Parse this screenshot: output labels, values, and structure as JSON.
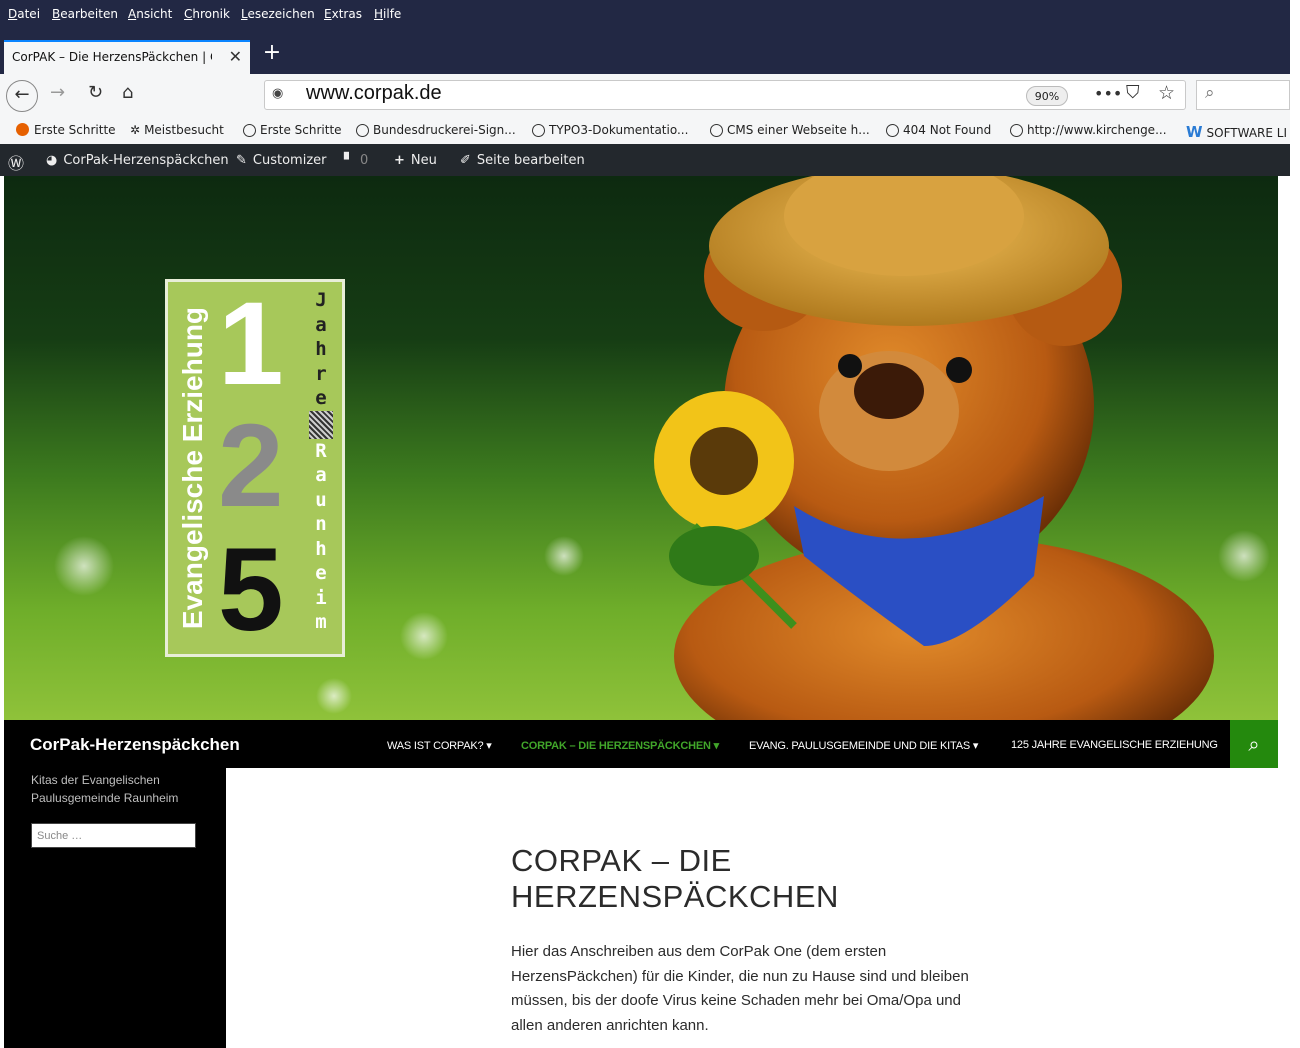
{
  "browser": {
    "menu": [
      "Datei",
      "Bearbeiten",
      "Ansicht",
      "Chronik",
      "Lesezeichen",
      "Extras",
      "Hilfe"
    ],
    "tab_title": "CorPAK – Die HerzensPäckchen | Co",
    "url": "www.corpak.de",
    "zoom": "90%",
    "bookmarks": [
      "Erste Schritte",
      "Meistbesucht",
      "Erste Schritte",
      "Bundesdruckerei-Sign...",
      "TYPO3-Dokumentatio...",
      "CMS einer Webseite h...",
      "404 Not Found",
      "http://www.kirchenge...",
      "SOFTWARE LI"
    ]
  },
  "wpbar": {
    "site": "CorPak-Herzenspäckchen",
    "customizer": "Customizer",
    "comments": "0",
    "new": "Neu",
    "edit": "Seite bearbeiten"
  },
  "hero": {
    "badge_vertical": "Evangelische Erziehung",
    "digits": [
      "1",
      "2",
      "5"
    ],
    "side_letters": [
      "J",
      "a",
      "h",
      "r",
      "e",
      "R",
      "a",
      "u",
      "n",
      "h",
      "e",
      "i",
      "m"
    ]
  },
  "site": {
    "title": "CorPak-Herzenspäckchen",
    "nav": [
      "WAS IST CORPAK?",
      "CORPAK – DIE HERZENSPÄCKCHEN",
      "EVANG. PAULUSGEMEINDE UND DIE KITAS",
      "125 JAHRE EVANGELISCHE ERZIEHUNG"
    ],
    "description": "Kitas der Evangelischen Paulusgemeinde Raunheim",
    "search_placeholder": "Suche …"
  },
  "content": {
    "title": "CORPAK – DIE HERZENSPÄCKCHEN",
    "paragraph": "Hier das Anschreiben aus dem CorPak One (dem ersten HerzensPäckchen) für die Kinder, die nun zu Hause sind und bleiben müssen, bis der doofe Virus keine Schaden mehr bei Oma/Opa und allen anderen anrichten kann."
  },
  "colors": {
    "browser_chrome": "#222844",
    "nav_active": "#41a62a",
    "search_button": "#24890d"
  }
}
